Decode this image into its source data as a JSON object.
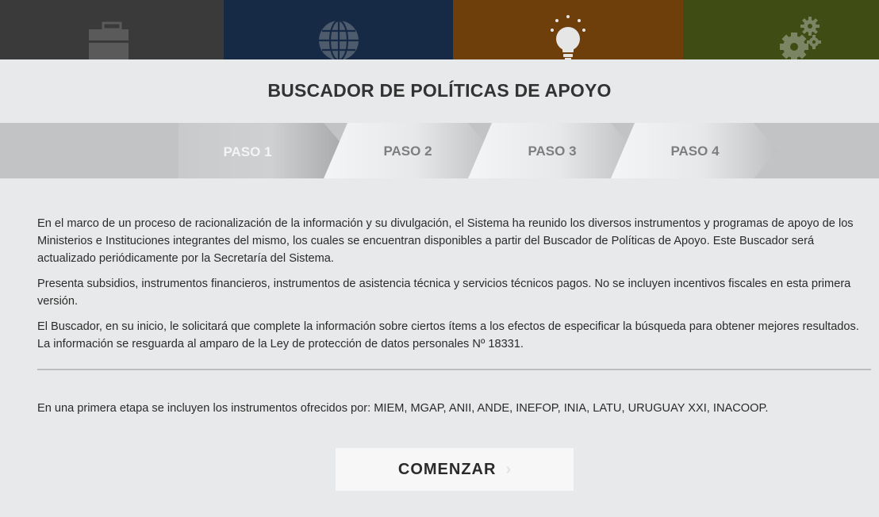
{
  "header_tiles": [
    {
      "icon": "briefcase-icon",
      "color": "#3a3a3a"
    },
    {
      "icon": "globe-icon",
      "color": "#162a45"
    },
    {
      "icon": "lightbulb-icon",
      "color": "#6e3e0b"
    },
    {
      "icon": "gears-icon",
      "color": "#3f4d14"
    }
  ],
  "page_title": "BUSCADOR DE POLÍTICAS DE APOYO",
  "steps": [
    {
      "label": "PASO 1",
      "active": true
    },
    {
      "label": "PASO 2",
      "active": false
    },
    {
      "label": "PASO 3",
      "active": false
    },
    {
      "label": "PASO 4",
      "active": false
    }
  ],
  "intro_paragraphs": [
    "En el marco de un proceso de racionalización de la información y su divulgación, el Sistema ha reunido los diversos instrumentos y programas de apoyo de los Ministerios e Instituciones integrantes del mismo, los cuales se encuentran disponibles a partir del Buscador de Políticas de Apoyo. Este Buscador será actualizado periódicamente por la Secretaría del Sistema.",
    "Presenta subsidios, instrumentos financieros, instrumentos de asistencia técnica y servicios técnicos pagos. No se incluyen incentivos fiscales en esta primera versión.",
    "El Buscador, en su inicio, le solicitará que complete la información sobre ciertos ítems a los efectos de especificar la búsqueda para obtener mejores resultados. La información se resguarda al amparo de la Ley de protección de datos personales Nº 18331."
  ],
  "instruments_text": "En una primera etapa se incluyen los instrumentos ofrecidos por: MIEM, MGAP, ANII, ANDE, INEFOP, INIA, LATU, URUGUAY XXI, INACOOP.",
  "start_button": {
    "label": "COMENZAR",
    "chevron": "›"
  }
}
